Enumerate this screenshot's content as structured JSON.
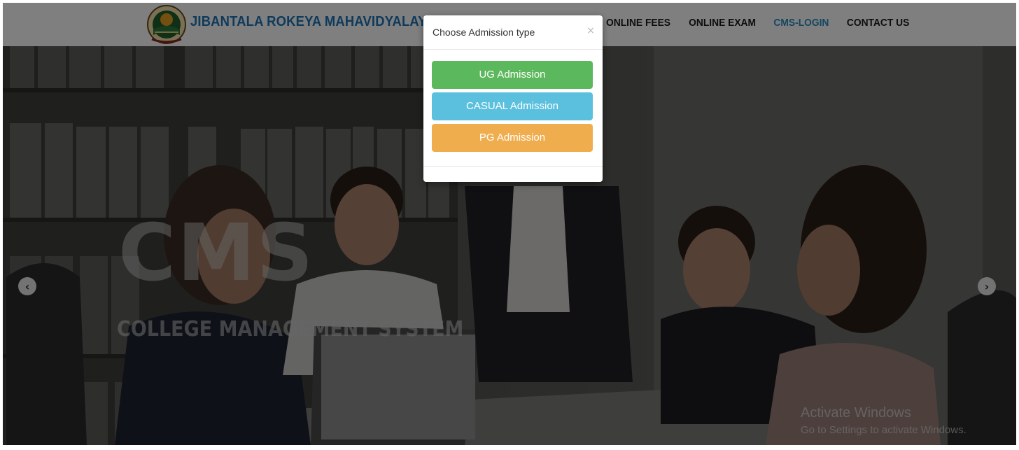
{
  "header": {
    "brand": "JIBANTALA ROKEYA MAHAVIDYALAYA",
    "nav": [
      "ONLINE FEES",
      "ONLINE EXAM",
      "CMS-LOGIN",
      "CONTACT US"
    ],
    "active_color": "#2b8cc4"
  },
  "hero": {
    "title": "CMS",
    "subtitle": "COLLEGE MANAGEMENT SYSTEM",
    "prev_icon": "chevron-left-icon",
    "next_icon": "chevron-right-icon"
  },
  "modal": {
    "title": "Choose Admission type",
    "close": "×",
    "buttons": [
      {
        "label": "UG Admission",
        "color": "#5cb85c"
      },
      {
        "label": "CASUAL Admission",
        "color": "#5bc0de"
      },
      {
        "label": "PG Admission",
        "color": "#f0ad4e"
      }
    ]
  },
  "watermark": {
    "line1": "Activate Windows",
    "line2": "Go to Settings to activate Windows."
  }
}
